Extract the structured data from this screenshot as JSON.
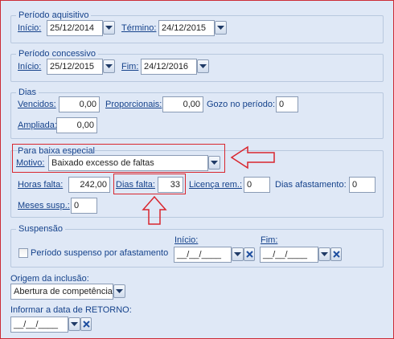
{
  "periodo_aquisitivo": {
    "legend": "Período aquisitivo",
    "inicio_label": "Início:",
    "inicio_value": "25/12/2014",
    "termino_label": "Término:",
    "termino_value": "24/12/2015"
  },
  "periodo_concessivo": {
    "legend": "Período concessivo",
    "inicio_label": "Início:",
    "inicio_value": "25/12/2015",
    "fim_label": "Fim:",
    "fim_value": "24/12/2016"
  },
  "dias": {
    "legend": "Dias",
    "vencidos_label": "Vencidos:",
    "vencidos_value": "0,00",
    "proporcionais_label": "Proporcionais:",
    "proporcionais_value": "0,00",
    "gozo_label": "Gozo no período:",
    "gozo_value": "0",
    "ampliada_label": "Ampliada:",
    "ampliada_value": "0,00"
  },
  "baixa_especial": {
    "legend": "Para baixa especial",
    "motivo_label": "Motivo:",
    "motivo_value": "Baixado excesso de faltas",
    "horas_falta_label": "Horas falta:",
    "horas_falta_value": "242,00",
    "dias_falta_label": "Dias falta:",
    "dias_falta_value": "33",
    "licenca_label": "Licença rem.:",
    "licenca_value": "0",
    "dias_afastamento_label": "Dias afastamento:",
    "dias_afastamento_value": "0",
    "meses_susp_label": "Meses susp.:",
    "meses_susp_value": "0"
  },
  "suspensao": {
    "legend": "Suspensão",
    "checkbox_label": "Período suspenso por afastamento",
    "inicio_label": "Início:",
    "inicio_value": "__/__/____",
    "fim_label": "Fim:",
    "fim_value": "__/__/____"
  },
  "origem": {
    "label": "Origem da inclusão:",
    "value": "Abertura de competência"
  },
  "retorno": {
    "label": "Informar a data de RETORNO:",
    "value": "__/__/____"
  },
  "colors": {
    "background": "#dfe8f6",
    "label": "#15428b",
    "highlight": "#d9262e"
  }
}
